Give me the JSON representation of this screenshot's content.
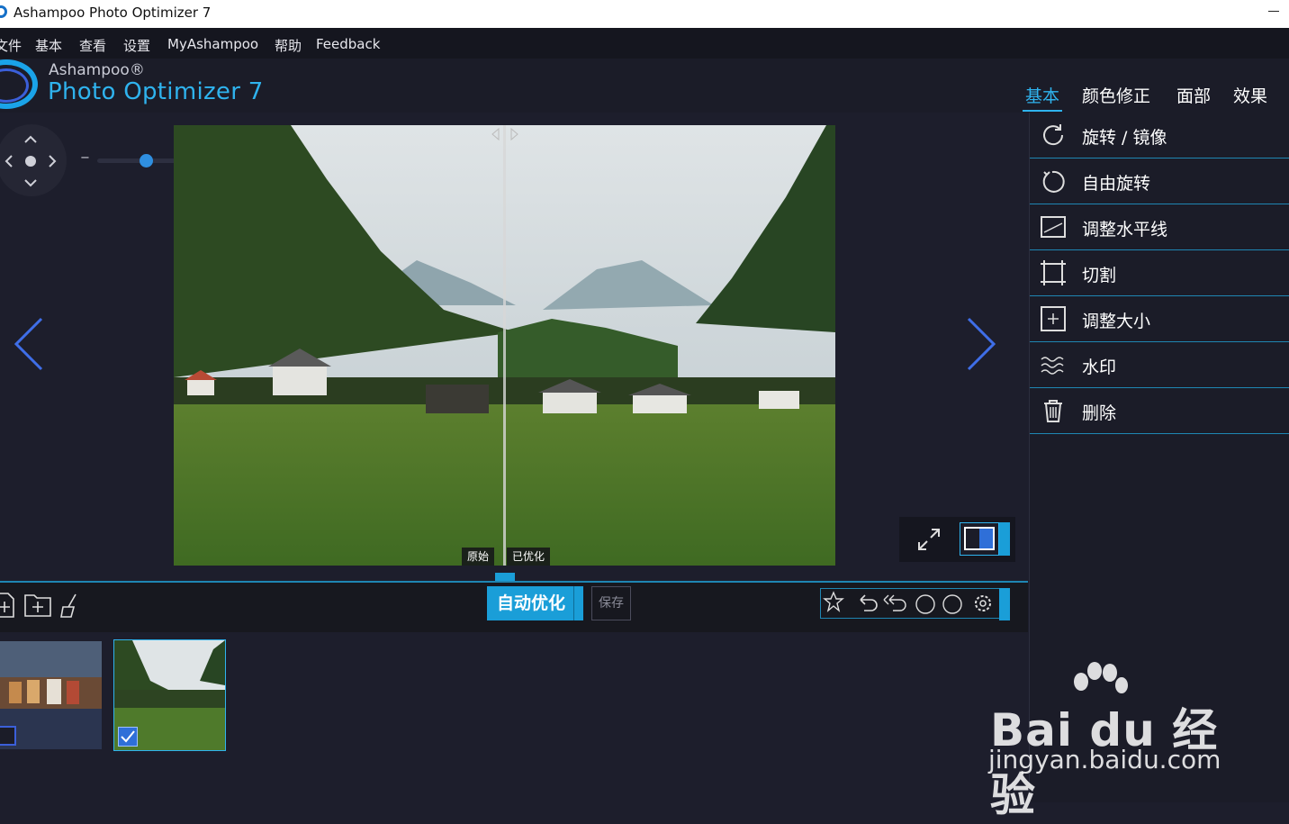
{
  "window": {
    "title": "Ashampoo Photo Optimizer 7"
  },
  "menu": [
    "文件",
    "基本",
    "查看",
    "设置",
    "MyAshampoo",
    "帮助",
    "Feedback"
  ],
  "brand": {
    "top": "Ashampoo®",
    "main": "Photo Optimizer 7"
  },
  "tabs": [
    {
      "label": "基本",
      "active": true
    },
    {
      "label": "颜色修正",
      "active": false
    },
    {
      "label": "面部",
      "active": false
    },
    {
      "label": "效果",
      "active": false
    }
  ],
  "tools": [
    {
      "label": "旋转 / 镜像",
      "icon": "rotate-mirror-icon"
    },
    {
      "label": "自由旋转",
      "icon": "free-rotate-icon"
    },
    {
      "label": "调整水平线",
      "icon": "horizon-icon"
    },
    {
      "label": "切割",
      "icon": "crop-icon"
    },
    {
      "label": "调整大小",
      "icon": "resize-icon"
    },
    {
      "label": "水印",
      "icon": "watermark-icon"
    },
    {
      "label": "删除",
      "icon": "trash-icon"
    }
  ],
  "zoom": {
    "minus": "−",
    "plus": "+",
    "level": 0.45
  },
  "compare": {
    "original": "原始",
    "optimized": "已优化"
  },
  "actions": {
    "auto_optimize": "自动优化",
    "save": "保存"
  },
  "watermark": {
    "brand": "Bai du 经验",
    "url": "jingyan.baidu.com"
  },
  "colors": {
    "accent": "#2fb3ee",
    "button": "#1a9ed8",
    "bg": "#1d1e2c"
  }
}
